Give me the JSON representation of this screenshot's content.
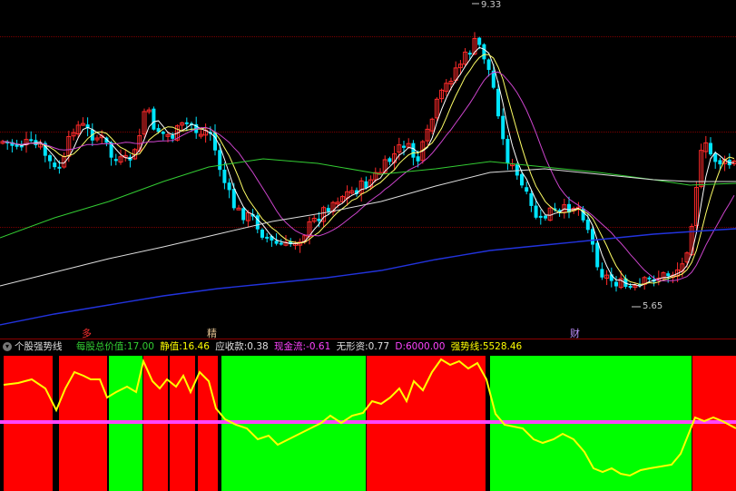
{
  "main_panel": {
    "high_label": "9.33",
    "low_label": "5.65",
    "markers": [
      {
        "text": "多",
        "color": "#ff3030"
      },
      {
        "text": "精",
        "color": "#e0c090"
      },
      {
        "text": "财",
        "color": "#c090ff"
      }
    ]
  },
  "indicator_bar": {
    "name": "个股强势线",
    "fields": [
      {
        "label": "每股总价值:",
        "value": "17.00",
        "color": "#32cd32"
      },
      {
        "label": "静值:",
        "value": "16.46",
        "color": "#ffff00"
      },
      {
        "label": "应收款:",
        "value": "0.38",
        "color": "#e0e0e0"
      },
      {
        "label": "现金流:",
        "value": "-0.61",
        "color": "#ff44ff"
      },
      {
        "label": "无形资:",
        "value": "0.77",
        "color": "#e0e0e0"
      },
      {
        "label": "D:",
        "value": "6000.00",
        "color": "#ff44ff"
      },
      {
        "label": "强势线:",
        "value": "5528.46",
        "color": "#ffff00"
      }
    ]
  },
  "colors": {
    "up": "#ff2a2a",
    "down": "#00e5ff",
    "ma5": "#ffffff",
    "ma10": "#ffff66",
    "ma20": "#cc44cc",
    "ma60": "#33cc33",
    "ma120": "#dddddd",
    "ma250": "#2233dd",
    "zone_red": "#ff0000",
    "zone_green": "#00ff00",
    "strength_line": "#ffff00",
    "baseline": "#ff44ff"
  }
}
